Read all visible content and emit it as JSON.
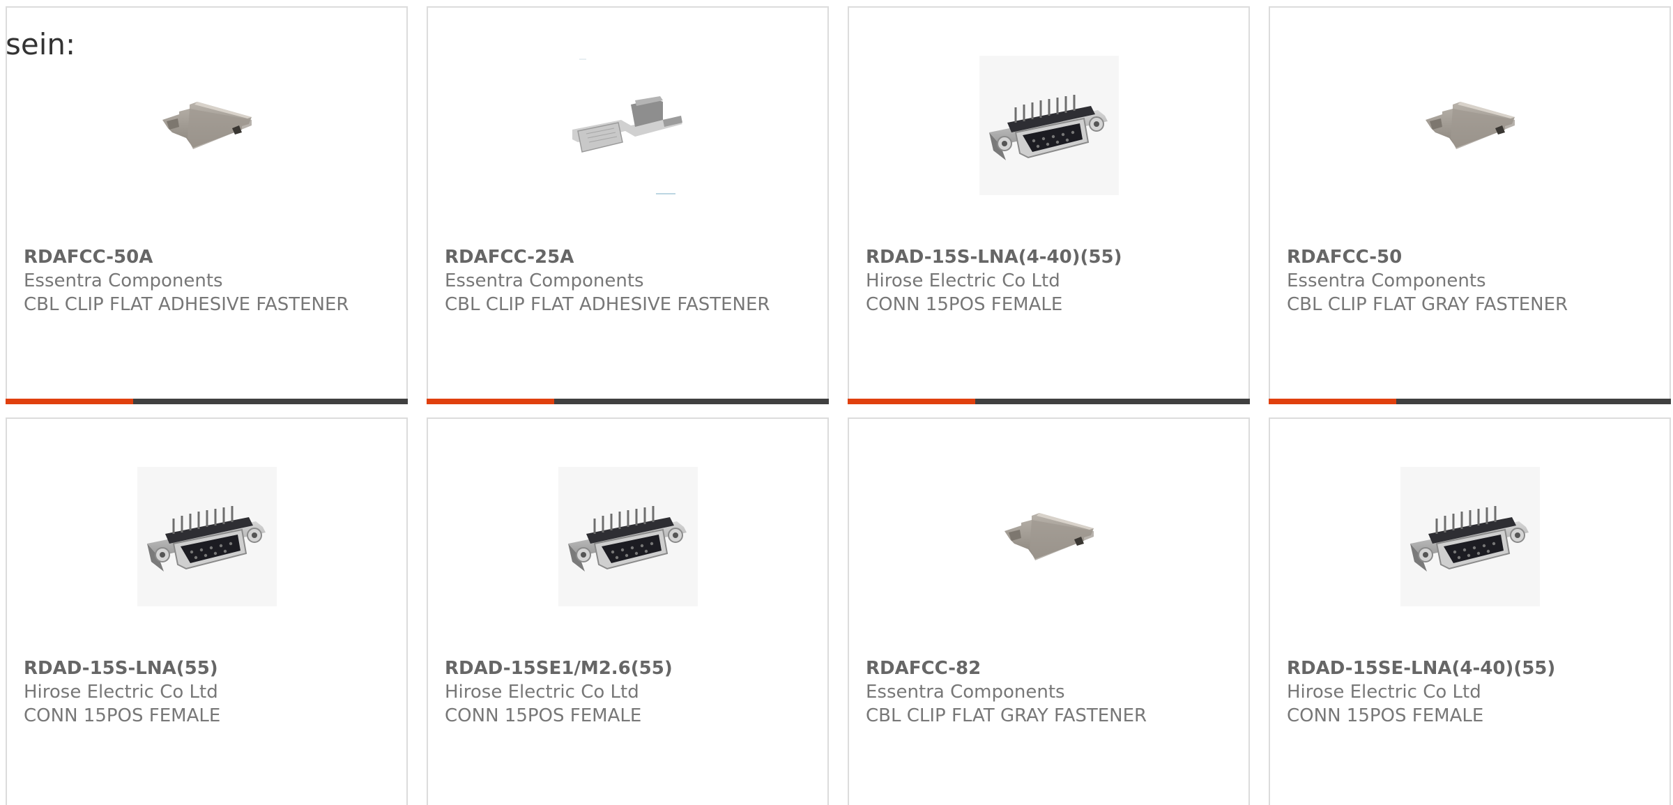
{
  "intro": {
    "text": "sein:"
  },
  "colors": {
    "accent": "#e0400e",
    "bar": "#404040",
    "border": "#dcdcdc",
    "text": "#777777"
  },
  "products": [
    {
      "part_no": "RDAFCC-50A",
      "manufacturer": "Essentra Components",
      "description": "CBL CLIP FLAT ADHESIVE FASTENER",
      "image": "clip-image"
    },
    {
      "part_no": "RDAFCC-25A",
      "manufacturer": "Essentra Components",
      "description": "CBL CLIP FLAT ADHESIVE FASTENER",
      "image": "clip-open-image"
    },
    {
      "part_no": "RDAD-15S-LNA(4-40)(55)",
      "manufacturer": "Hirose Electric Co Ltd",
      "description": "CONN 15POS FEMALE",
      "image": "dsub-connector-image"
    },
    {
      "part_no": "RDAFCC-50",
      "manufacturer": "Essentra Components",
      "description": "CBL CLIP FLAT GRAY FASTENER",
      "image": "clip-image"
    },
    {
      "part_no": "RDAD-15S-LNA(55)",
      "manufacturer": "Hirose Electric Co Ltd",
      "description": "CONN 15POS FEMALE",
      "image": "dsub-connector-image"
    },
    {
      "part_no": "RDAD-15SE1/M2.6(55)",
      "manufacturer": "Hirose Electric Co Ltd",
      "description": "CONN 15POS FEMALE",
      "image": "dsub-connector-image"
    },
    {
      "part_no": "RDAFCC-82",
      "manufacturer": "Essentra Components",
      "description": "CBL CLIP FLAT GRAY FASTENER",
      "image": "clip-image"
    },
    {
      "part_no": "RDAD-15SE-LNA(4-40)(55)",
      "manufacturer": "Hirose Electric Co Ltd",
      "description": "CONN 15POS FEMALE",
      "image": "dsub-connector-image"
    }
  ]
}
